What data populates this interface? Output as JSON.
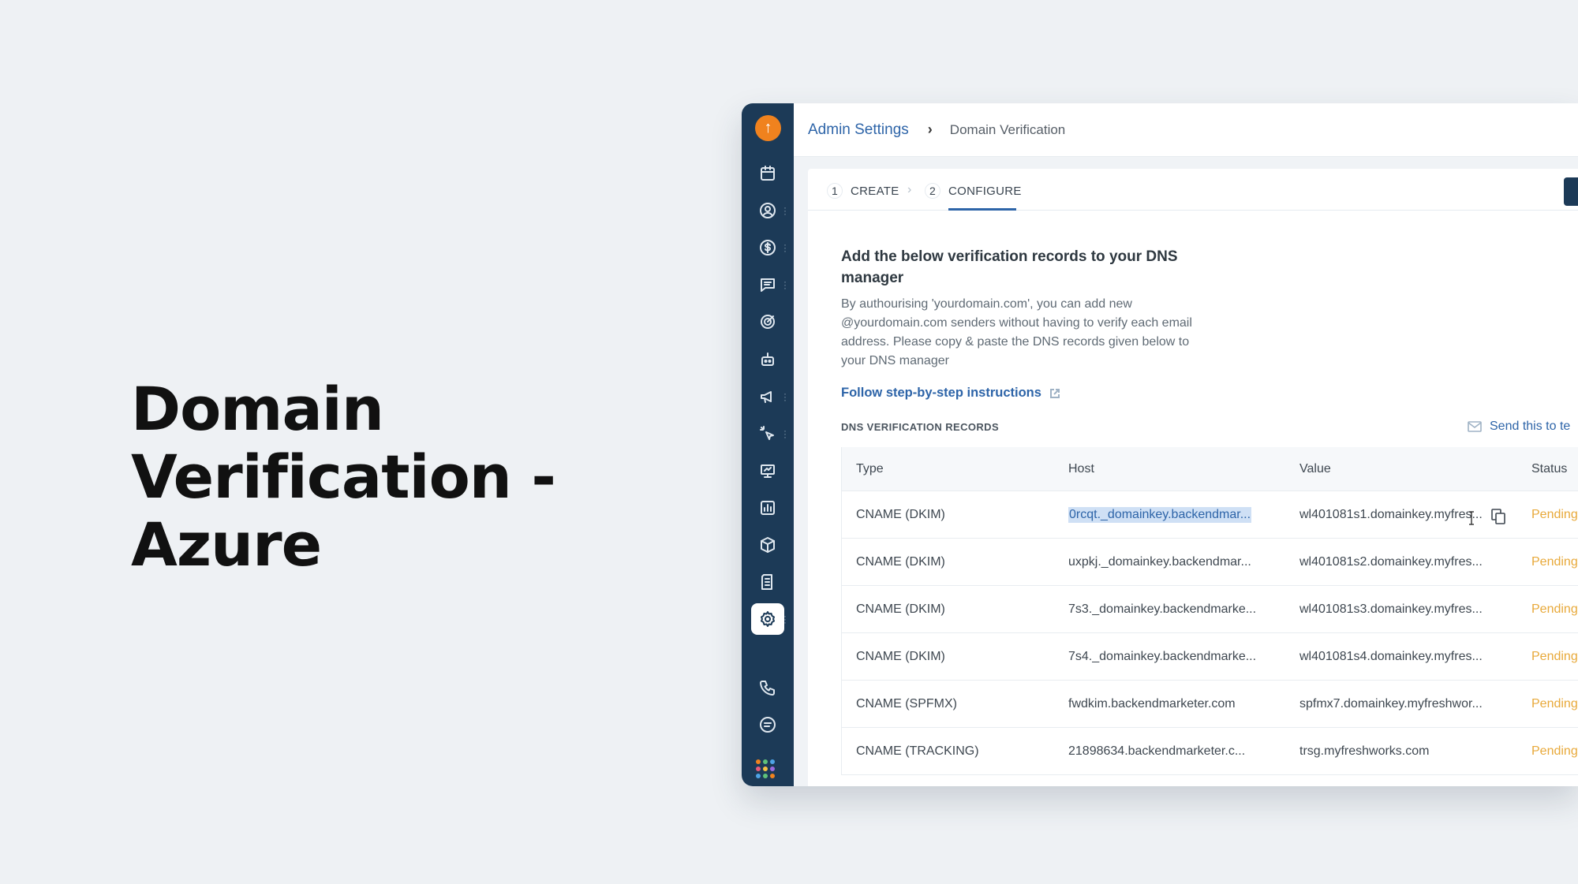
{
  "hero": {
    "line1": "Domain",
    "line2": "Verification - Azure"
  },
  "sidebar": {
    "logo_icon": "rocket-logo-icon",
    "items": [
      {
        "icon": "calendar-icon"
      },
      {
        "icon": "contact-icon"
      },
      {
        "icon": "dollar-icon"
      },
      {
        "icon": "chat-icon"
      },
      {
        "icon": "target-icon"
      },
      {
        "icon": "bot-icon"
      },
      {
        "icon": "megaphone-icon"
      },
      {
        "icon": "click-icon"
      },
      {
        "icon": "monitor-icon"
      },
      {
        "icon": "reports-icon"
      },
      {
        "icon": "box-icon"
      },
      {
        "icon": "document-icon"
      },
      {
        "icon": "settings-icon",
        "active": true
      },
      {
        "icon": "phone-icon"
      },
      {
        "icon": "message-icon"
      },
      {
        "icon": "apps-grid-icon"
      }
    ]
  },
  "breadcrumb": {
    "parent": "Admin Settings",
    "separator": "›",
    "current": "Domain Verification"
  },
  "stepper": {
    "steps": [
      {
        "number": "1",
        "label": "CREATE"
      },
      {
        "number": "2",
        "label": "CONFIGURE",
        "active": true
      }
    ],
    "separator": "›"
  },
  "content": {
    "title": "Add the below verification records to your DNS manager",
    "description": "By authourising 'yourdomain.com', you can add new @yourdomain.com senders without having to verify each email address. Please copy & paste the DNS records given below to your DNS manager",
    "instructions_link": "Follow step-by-step instructions",
    "records_label": "DNS VERIFICATION RECORDS",
    "send_link": "Send this to te"
  },
  "table": {
    "columns": [
      "Type",
      "Host",
      "Value",
      "Status"
    ],
    "rows": [
      {
        "type": "CNAME (DKIM)",
        "host": "0rcqt._domainkey.backendmar...",
        "value": "wl401081s1.domainkey.myfres...",
        "status": "Pending"
      },
      {
        "type": "CNAME (DKIM)",
        "host": "uxpkj._domainkey.backendmar...",
        "value": "wl401081s2.domainkey.myfres...",
        "status": "Pending"
      },
      {
        "type": "CNAME (DKIM)",
        "host": "7s3._domainkey.backendmarke...",
        "value": "wl401081s3.domainkey.myfres...",
        "status": "Pending"
      },
      {
        "type": "CNAME (DKIM)",
        "host": "7s4._domainkey.backendmarke...",
        "value": "wl401081s4.domainkey.myfres...",
        "status": "Pending"
      },
      {
        "type": "CNAME (SPFMX)",
        "host": "fwdkim.backendmarketer.com",
        "value": "spfmx7.domainkey.myfreshwor...",
        "status": "Pending"
      },
      {
        "type": "CNAME (TRACKING)",
        "host": "21898634.backendmarketer.c...",
        "value": "trsg.myfreshworks.com",
        "status": "Pending"
      }
    ]
  },
  "colors": {
    "sidebar": "#1c3a57",
    "accent": "#2d64a8",
    "pending": "#e8a93a",
    "logo": "#f0821e"
  }
}
